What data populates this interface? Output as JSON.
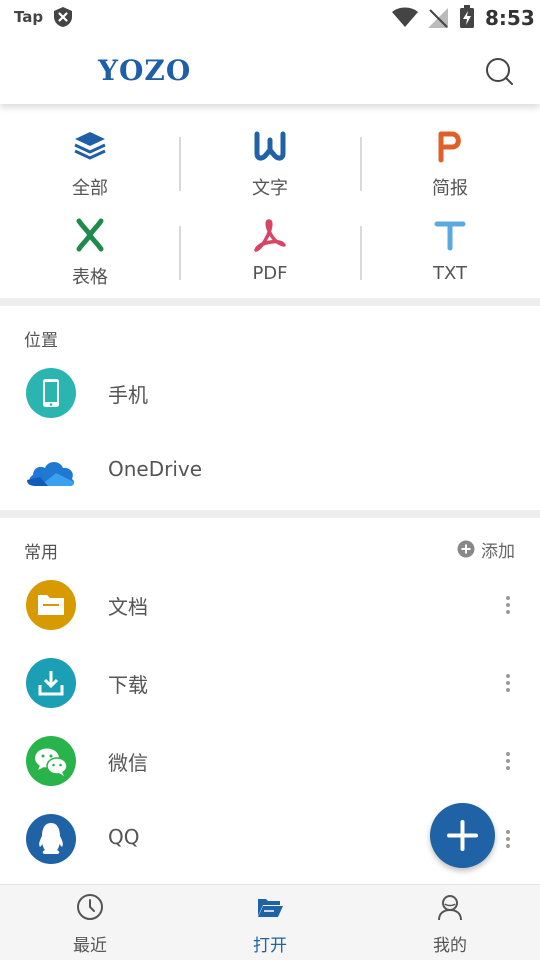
{
  "status_bar": {
    "carrier_text": "Tap",
    "time": "8:53"
  },
  "header": {
    "logo": "YOZO",
    "search_icon": "search-icon"
  },
  "categories": [
    {
      "label": "全部",
      "icon": "layers-icon",
      "color": "#1f5fa8"
    },
    {
      "label": "文字",
      "icon": "word-w-icon",
      "color": "#1f62a5"
    },
    {
      "label": "简报",
      "icon": "presentation-p-icon",
      "color": "#e0602c"
    },
    {
      "label": "表格",
      "icon": "spreadsheet-x-icon",
      "color": "#1e8a4c"
    },
    {
      "label": "PDF",
      "icon": "pdf-icon",
      "color": "#d84463"
    },
    {
      "label": "TXT",
      "icon": "text-t-icon",
      "color": "#5aaae0"
    }
  ],
  "locations": {
    "title": "位置",
    "items": [
      {
        "label": "手机",
        "icon": "phone-icon",
        "color": "#2bb5b0"
      },
      {
        "label": "OneDrive",
        "icon": "onedrive-cloud-icon",
        "color": "#1f6fc5"
      }
    ]
  },
  "favorites": {
    "title": "常用",
    "add_label": "添加",
    "items": [
      {
        "label": "文档",
        "icon": "folder-icon",
        "color": "#d79a00"
      },
      {
        "label": "下载",
        "icon": "download-icon",
        "color": "#1a9fb5"
      },
      {
        "label": "微信",
        "icon": "wechat-icon",
        "color": "#28b44a"
      },
      {
        "label": "QQ",
        "icon": "qq-penguin-icon",
        "color": "#1f62a5"
      }
    ]
  },
  "fab": {
    "icon": "plus-icon",
    "color": "#1f62a5"
  },
  "bottom_nav": {
    "items": [
      {
        "label": "最近",
        "icon": "clock-icon",
        "active": false
      },
      {
        "label": "打开",
        "icon": "open-folder-icon",
        "active": true
      },
      {
        "label": "我的",
        "icon": "user-icon",
        "active": false
      }
    ]
  }
}
